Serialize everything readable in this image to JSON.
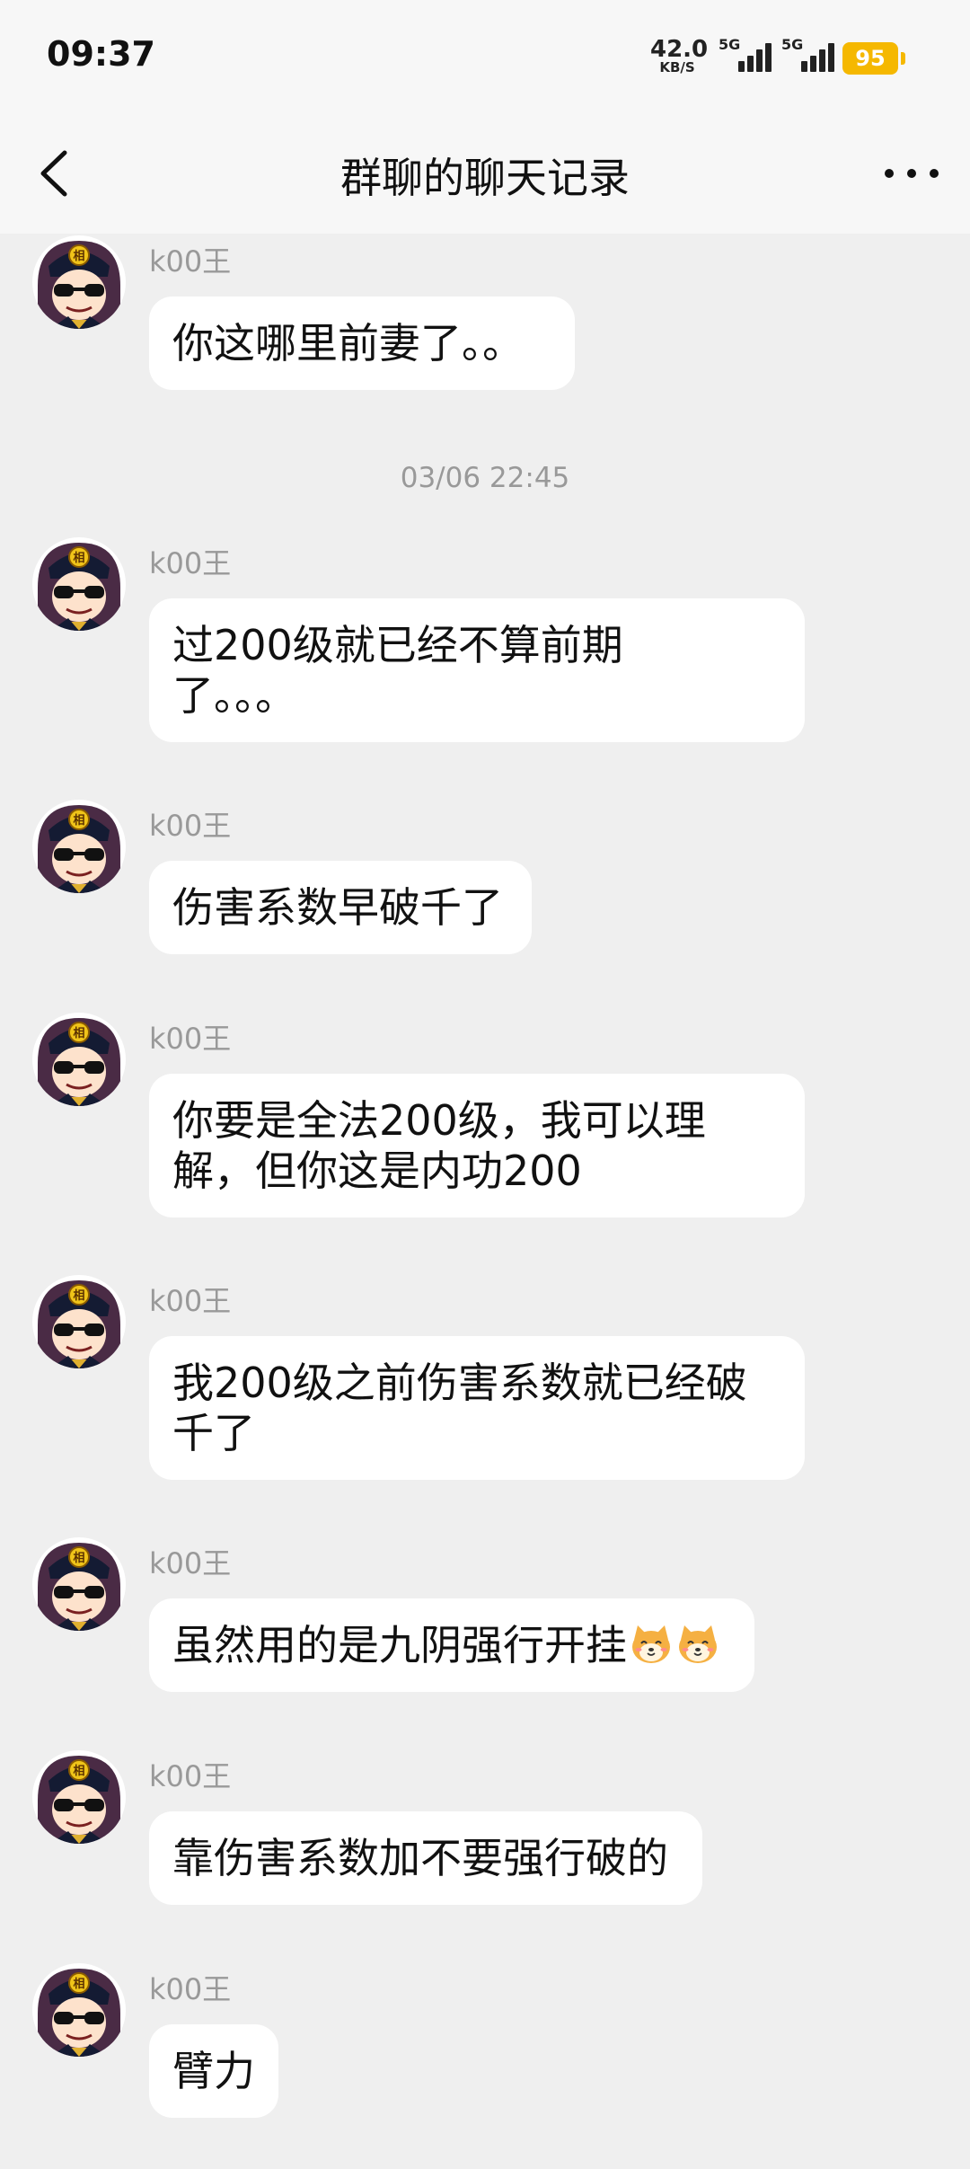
{
  "status_bar": {
    "time": "09:37",
    "net_speed_value": "42.0",
    "net_speed_unit": "KB/S",
    "sim1_label": "5G",
    "sim2_label": "5G",
    "battery": "95"
  },
  "header": {
    "title": "群聊的聊天记录",
    "back_icon": "chevron-left-icon",
    "more_icon": "more-dots-icon"
  },
  "messages": [
    {
      "sender": "k00王",
      "text": "你这哪里前妻了。。"
    },
    {
      "timestamp": "03/06 22:45"
    },
    {
      "sender": "k00王",
      "text": "过200级就已经不算前期了。。。"
    },
    {
      "sender": "k00王",
      "text": "伤害系数早破千了"
    },
    {
      "sender": "k00王",
      "text": "你要是全法200级，我可以理解，但你这是内功200"
    },
    {
      "sender": "k00王",
      "text": "我200级之前伤害系数就已经破千了"
    },
    {
      "sender": "k00王",
      "text": "虽然用的是九阴强行开挂",
      "emojis": [
        "shiba-emoji",
        "shiba-emoji"
      ]
    },
    {
      "sender": "k00王",
      "text": "靠伤害系数加不要强行破的"
    },
    {
      "sender": "k00王",
      "text": "臂力"
    }
  ],
  "colors": {
    "background": "#efefef",
    "bubble": "#ffffff",
    "battery": "#f5b800",
    "sender_text": "#999999"
  }
}
